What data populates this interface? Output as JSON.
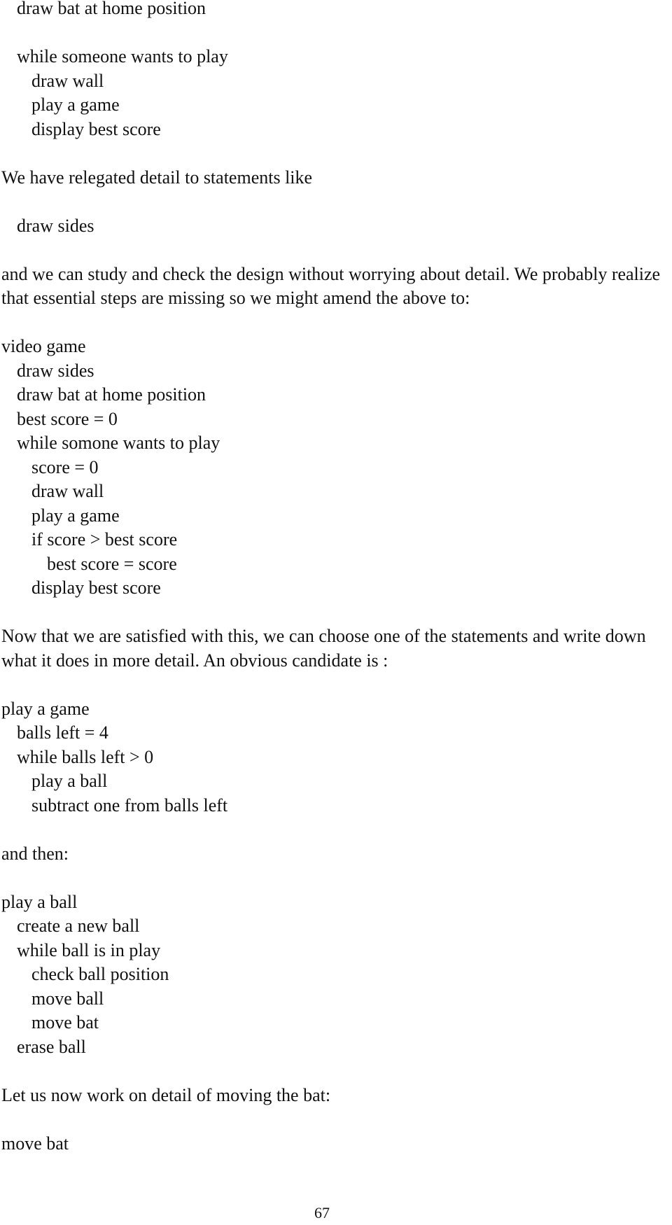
{
  "document": {
    "block1": [
      {
        "text": "draw bat at home position",
        "indent": 1
      },
      {
        "text": "",
        "indent": 0
      },
      {
        "text": "while someone wants to play",
        "indent": 1
      },
      {
        "text": "draw wall",
        "indent": 2
      },
      {
        "text": "play a game",
        "indent": 2
      },
      {
        "text": "display best score",
        "indent": 2
      }
    ],
    "para1": "We have relegated detail to statements like",
    "example_statement": "draw sides",
    "para2": "and we can study and check the design without worrying about detail. We probably realize that essential steps are missing so we might amend the above to:",
    "block2": [
      {
        "text": "video game",
        "indent": 0
      },
      {
        "text": "draw sides",
        "indent": 1
      },
      {
        "text": "draw bat at home position",
        "indent": 1
      },
      {
        "text": "best score = 0",
        "indent": 1
      },
      {
        "text": "while somone wants to play",
        "indent": 1
      },
      {
        "text": "score = 0",
        "indent": 2
      },
      {
        "text": "draw wall",
        "indent": 2
      },
      {
        "text": "play a game",
        "indent": 2
      },
      {
        "text": "if score > best score",
        "indent": 2
      },
      {
        "text": "best score = score",
        "indent": 3
      },
      {
        "text": "display best score",
        "indent": 2
      }
    ],
    "para3": "Now that we are satisfied with this, we can choose one of the statements and write down what it does in more detail. An obvious candidate is :",
    "block3": [
      {
        "text": "play a game",
        "indent": 0
      },
      {
        "text": "balls left = 4",
        "indent": 1
      },
      {
        "text": "while balls left > 0",
        "indent": 1
      },
      {
        "text": "play a ball",
        "indent": 2
      },
      {
        "text": "subtract one from balls left",
        "indent": 2
      }
    ],
    "para4": "and then:",
    "block4": [
      {
        "text": "play a ball",
        "indent": 0
      },
      {
        "text": "create a new ball",
        "indent": 1
      },
      {
        "text": "while ball is in play",
        "indent": 1
      },
      {
        "text": "check ball position",
        "indent": 2
      },
      {
        "text": "move ball",
        "indent": 2
      },
      {
        "text": "move bat",
        "indent": 2
      },
      {
        "text": "erase ball",
        "indent": 1
      }
    ],
    "para5": "Let us now work on detail of moving the bat:",
    "block5": [
      {
        "text": "move bat",
        "indent": 0
      }
    ],
    "page_number": "67"
  }
}
